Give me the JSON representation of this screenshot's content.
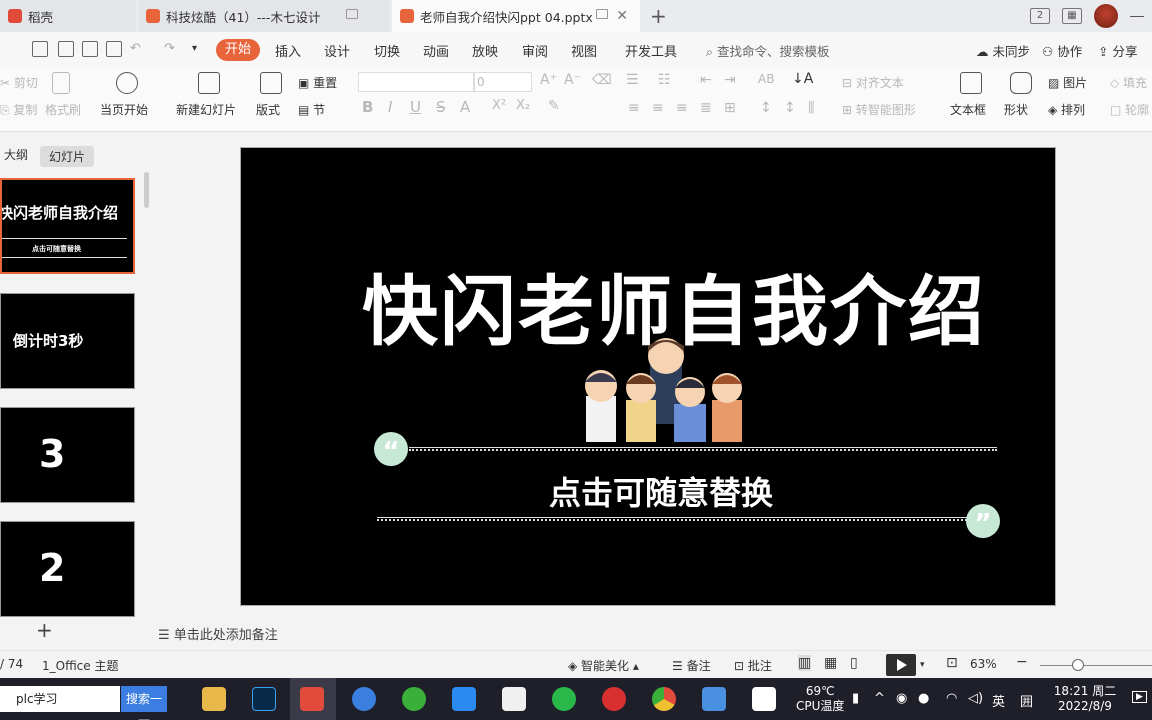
{
  "tabs": [
    {
      "label": "稻壳",
      "color": "#e24a3c"
    },
    {
      "label": "科技炫酷（41）---木七设计",
      "color": "#e8643a"
    },
    {
      "label": "老师自我介绍快闪ppt 04.pptx",
      "color": "#e8643a"
    }
  ],
  "window": {
    "new_tab": "+",
    "min": "—"
  },
  "menu": {
    "items": [
      "开始",
      "插入",
      "设计",
      "切换",
      "动画",
      "放映",
      "审阅",
      "视图",
      "开发工具"
    ],
    "search": "查找命令、搜索模板",
    "right": [
      "未同步",
      "协作",
      "分享"
    ]
  },
  "ribbon": {
    "cut": "剪切",
    "copy": "复制",
    "format_painter": "格式刷",
    "from_current": "当页开始",
    "new_slide": "新建幻灯片",
    "layout": "版式",
    "reset": "重置",
    "section": "节",
    "font_size": "0",
    "align_text": "对齐文本",
    "smart_shape": "转智能图形",
    "textbox": "文本框",
    "shape": "形状",
    "picture": "图片",
    "arrange": "排列",
    "fill": "填充",
    "outline": "轮廓"
  },
  "left_panel": {
    "tabs": [
      "大纲",
      "幻灯片"
    ],
    "thumbnails": [
      {
        "title": "快闪老师自我介绍",
        "subtitle": "点击可随意替换"
      },
      {
        "title": "倒计时3秒"
      },
      {
        "title": "3"
      },
      {
        "title": "2"
      }
    ],
    "add": "+"
  },
  "slide": {
    "title": "快闪老师自我介绍",
    "subtitle": "点击可随意替换",
    "quote_open": "“",
    "quote_close": "”"
  },
  "notes_placeholder": "单击此处添加备注",
  "status": {
    "page": "/ 74",
    "theme": "1_Office 主题",
    "beautify": "智能美化",
    "notes": "备注",
    "comments": "批注",
    "zoom": "63%"
  },
  "taskbar": {
    "search_value": "plc学习",
    "search_button": "搜索一下",
    "temp": "69℃",
    "temp_label": "CPU温度",
    "ime": "英",
    "ime2": "囲",
    "time": "18:21 周二",
    "date": "2022/8/9"
  }
}
